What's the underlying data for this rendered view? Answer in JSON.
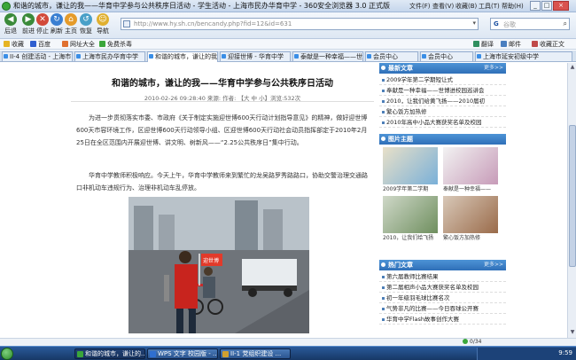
{
  "window": {
    "title": "和谐的城市，谦让的我——华育中学参与公共秩序日活动 - 学生活动 - 上海市民办华育中学 - 360安全浏览器 3.0 正式版",
    "menu": [
      "文件(F)",
      "查看(V)",
      "收藏(B)",
      "工具(T)",
      "帮助(H)"
    ],
    "controls": {
      "minimize": "_",
      "maximize": "□",
      "close": "×"
    }
  },
  "toolbar": {
    "back": "后退",
    "forward": "前进",
    "stop": "停止",
    "refresh": "刷新",
    "home": "主页",
    "restore": "恢复",
    "nav": "导航"
  },
  "address": {
    "url": "http://www.hy.sh.cn/bencandy.php?fid=12&id=631"
  },
  "search": {
    "engine": "G",
    "placeholder": "谷歌"
  },
  "favorites": {
    "items": [
      "收藏",
      "百度",
      "网址大全",
      "免费杀毒"
    ],
    "right": [
      "翻译",
      "邮件",
      "收藏正文"
    ]
  },
  "tabs": [
    {
      "label": "II-4 创建活动 - 上海市"
    },
    {
      "label": "上海市民办华育中学"
    },
    {
      "label": "和谐的城市，谦让的我"
    },
    {
      "label": "迎接世博 - 华育中学"
    },
    {
      "label": "泰献是一种幸福——世博"
    },
    {
      "label": "会员中心"
    },
    {
      "label": "会员中心"
    },
    {
      "label": "上海市延安初级中学"
    }
  ],
  "article": {
    "title": "和谐的城市，谦让的我——华育中学参与公共秩序日活动",
    "meta": "2010-02-26 09:28:40 来源: 作者: 【大 中 小】浏览:532次",
    "para1": "为进一步贯彻落实市委、市政府《关于制定实施迎世博600天行动计划指导意见》的精神，做好迎世博600天市容环境工作，区迎世博600天行动领导小组、区迎世博600天行动社会动员指挥部定于2010年2月25日在全区范围内开展迎世博、讲文明、树新风——“2.25公共秩序日”集中行动。",
    "para2": "华育中学教师积极响应。今天上午，华育中学教师来到繁忙的龙吴路罗秀路路口，协助交警治理交通路口非机动车违规行为、治理非机动车乱停放。",
    "photo_flag": "迎世博"
  },
  "sidebar": {
    "latest": {
      "title": "最新文章",
      "more": "更多>>",
      "items": [
        "2009学年第二学期短让式",
        "奉献是一种幸福——世博进校园巡讲会",
        "2010，让我们给黄飞扬——2010届初",
        "繁心饭方加热修",
        "2010年高中小品大赛获奖名单及校园"
      ]
    },
    "gallery": {
      "title": "图片主题",
      "items": [
        {
          "caption": "2009学年第二学期"
        },
        {
          "caption": "奉献是一种幸福——"
        },
        {
          "caption": "2010，让我们给飞扬"
        },
        {
          "caption": "繁心饭方加热修"
        }
      ]
    },
    "hot": {
      "title": "热门文章",
      "more": "更多>>",
      "items": [
        "第六届教师比赛结果",
        "第二届相声小品大赛获奖名单及校园",
        "初一年级羽毛球比赛名次",
        "气势非凡的比赛——今日吞球公开赛",
        "华育中学Flash故事创作大赛"
      ]
    }
  },
  "status": {
    "zoom": "0/34"
  },
  "taskbar": {
    "tasks": [
      "和谐的城市，谦让的...",
      "WPS 文字 校园版 - ...",
      "II-1 党组织建设 ..."
    ],
    "clock": "9:59"
  }
}
